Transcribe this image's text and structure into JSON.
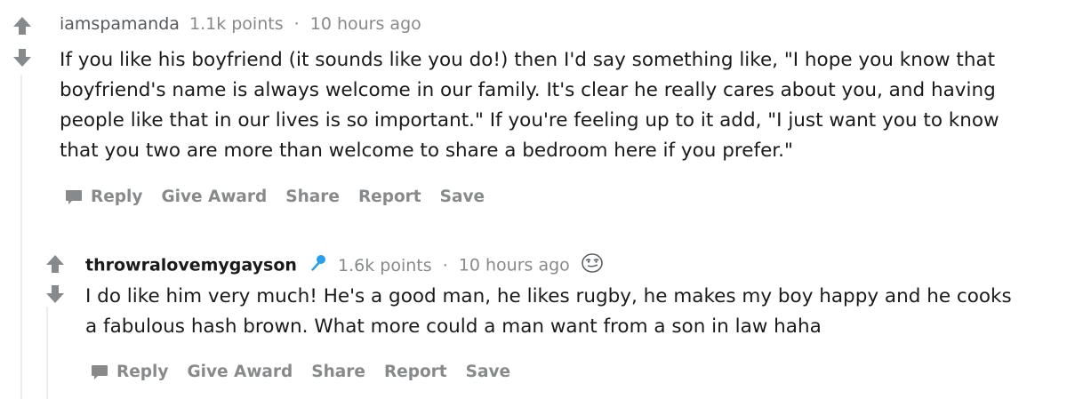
{
  "comments": [
    {
      "author": "iamspamanda",
      "points": "1.1k points",
      "separator": "·",
      "time": "10 hours ago",
      "body_lines": [
        "If you like his boyfriend (it sounds like you do!) then I'd say something like, \"I hope you know that",
        "boyfriend's name is always welcome in our family. It's clear he really cares about you, and having",
        "people like that in our lives is so important.\" If you're feeling up to it add, \"I just want you to know",
        "that you two are more than welcome to share a bedroom here if you prefer.\""
      ],
      "actions": {
        "reply": "Reply",
        "give_award": "Give Award",
        "share": "Share",
        "report": "Report",
        "save": "Save"
      }
    },
    {
      "author": "throwralovemygayson",
      "author_icon": "microphone-icon",
      "points": "1.6k points",
      "separator": "·",
      "time": "10 hours ago",
      "flair_icon": "smirk-face-icon",
      "body_lines": [
        "I do like him very much! He's a good man, he likes rugby, he makes my boy happy and he cooks",
        "a fabulous hash brown. What more could a man want from a son in law haha"
      ],
      "actions": {
        "reply": "Reply",
        "give_award": "Give Award",
        "share": "Share",
        "report": "Report",
        "save": "Save"
      }
    }
  ],
  "colors": {
    "arrow": "#878a8c",
    "meta_text": "#878a8c",
    "body_text": "#1a1a1b",
    "thread_line": "#ededed",
    "mic_blue": "#24a0ed"
  }
}
